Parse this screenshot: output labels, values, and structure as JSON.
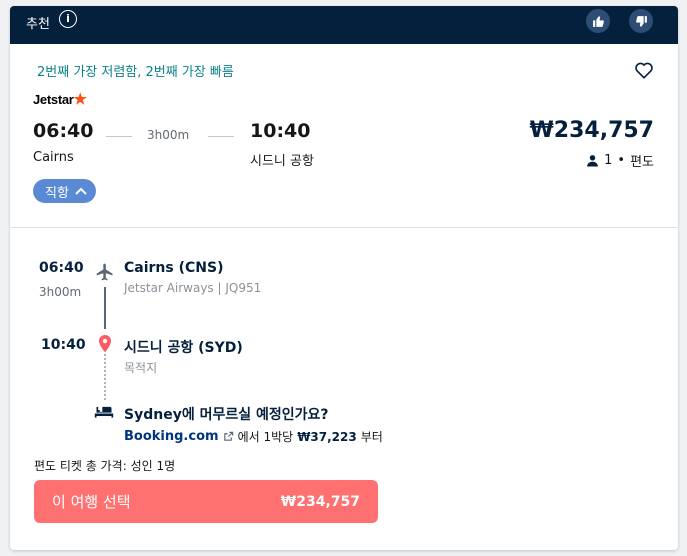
{
  "banner": {
    "title": "추천",
    "info_icon": "i",
    "icons": [
      "info-icon",
      "thumbs-up-icon",
      "thumbs-down-icon"
    ]
  },
  "summary": {
    "tagline": "2번째 가장 저렴함, 2번째 가장 빠름",
    "airline_logo": "Jetstar",
    "departure_time": "06:40",
    "departure_city": "Cairns",
    "duration": "3h00m",
    "arrival_time": "10:40",
    "arrival_city": "시드니 공항",
    "price": "₩234,757",
    "passengers": "1",
    "trip_type": "편도",
    "stops_label": "직항",
    "icons": [
      "heart-icon",
      "person-icon",
      "chevron-up-icon"
    ]
  },
  "itinerary": {
    "departure_time": "06:40",
    "duration": "3h00m",
    "arrival_time": "10:40",
    "origin": "Cairns (CNS)",
    "airline_flight": "Jetstar Airways | JQ951",
    "destination": "시드니 공항 (SYD)",
    "destination_label": "목적지",
    "stay_question": "Sydney에 머무르실 예정인가요?",
    "booking_brand": "Booking.com",
    "stay_text_mid": "에서 1박당",
    "stay_price": "₩37,223",
    "stay_text_end": "부터",
    "icons": [
      "plane-icon",
      "location-pin-icon",
      "bed-icon",
      "external-link-icon"
    ]
  },
  "footer": {
    "total_label": "편도 티켓 총 가격: 성인 1명",
    "select_label": "이 여행 선택",
    "select_price": "₩234,757"
  },
  "colors": {
    "banner_bg": "#05203c",
    "tagline": "#0c838a",
    "direct_pill": "#5b8ad4",
    "cta": "#ff7070",
    "jetstar_star": "#ff5115"
  }
}
